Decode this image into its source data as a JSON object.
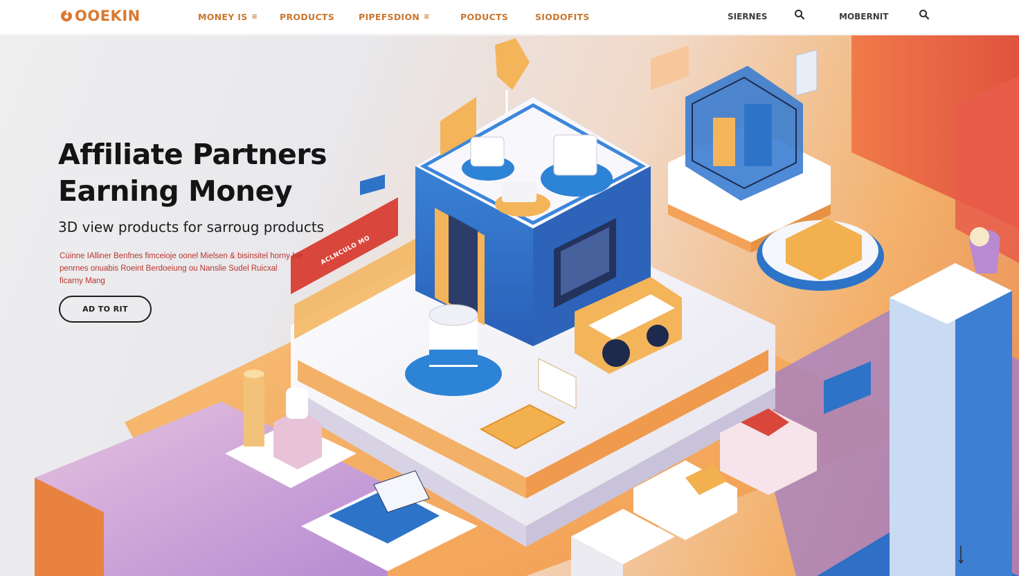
{
  "brand": {
    "name": "OOEKIN",
    "accent": "#d9782e"
  },
  "nav": {
    "items": [
      {
        "label": "MONEY IS",
        "has_dropdown": true
      },
      {
        "label": "PRODUCTS",
        "has_dropdown": false
      },
      {
        "label": "PIPEFSDION",
        "has_dropdown": true
      },
      {
        "label": "PODUCTS",
        "has_dropdown": false
      },
      {
        "label": "SIODOFITS",
        "has_dropdown": false
      }
    ],
    "right_items": [
      {
        "label": "SIERNES"
      },
      {
        "label": "MOBERNIT"
      }
    ],
    "search_icon": "search-icon"
  },
  "hero": {
    "title_line1": "Affiliate Partners",
    "title_line2": "Earning Money",
    "subtitle": "3D view products for sarroug products",
    "body_line1": "Cúinne IAlliner Benfnes fimceioje oonel Mielsen & bisinsitel horny hie",
    "body_line2": "penrnes onuabis Roeint Berdoeiung ou Nanslie Sudel Ruicxal",
    "body_line3": "ficarny Mang",
    "cta_label": "AD TO RIT",
    "banner_text": "ACLNCULO MO"
  },
  "colors": {
    "text_dark": "#141414",
    "body_red": "#b8352c",
    "orange": "#f3a955",
    "blue": "#2d74c8",
    "purple": "#b98ad1",
    "pink": "#e8c2d6"
  }
}
